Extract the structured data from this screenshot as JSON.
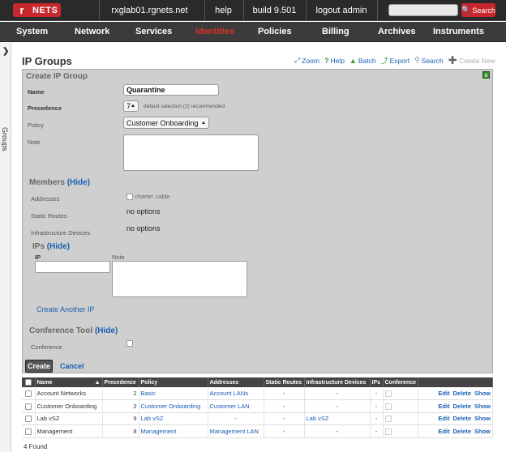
{
  "topbar": {
    "logo_letter": "r",
    "logo_text": "NETS",
    "host": "rxglab01.rgnets.net",
    "help": "help",
    "build": "build 9.501",
    "logout": "logout admin",
    "search_value": "",
    "search_label": "Search"
  },
  "nav": {
    "items": [
      "System",
      "Network",
      "Services",
      "Identities",
      "Policies",
      "Billing",
      "Archives",
      "Instruments"
    ],
    "active": "Identities",
    "active_color": "#d93025"
  },
  "sidebar": {
    "label": "Groups"
  },
  "page": {
    "title": "IP Groups"
  },
  "toolbar": {
    "zoom": "Zoom",
    "help": "Help",
    "batch": "Batch",
    "export": "Export",
    "search": "Search",
    "create_new": "Create New"
  },
  "form": {
    "title": "Create IP Group",
    "name_label": "Name",
    "name_value": "Quarantine",
    "precedence_label": "Precedence",
    "precedence_value": "7",
    "precedence_hint": "default selection (2) recommended",
    "policy_label": "Policy",
    "policy_value": "Customer Onboarding",
    "note_label": "Note",
    "members_head": "Members",
    "hide": "(Hide)",
    "addresses_label": "Addresses",
    "addresses_option": "charter cable",
    "static_routes_label": "Static Routes",
    "static_routes_value": "no options",
    "infra_label": "Infrastructure Devices",
    "infra_value": "no options",
    "ips_head": "IPs",
    "ip_col": "IP",
    "note_col": "Note",
    "create_another": "Create Another IP",
    "conf_head": "Conference Tool",
    "conference_label": "Conference",
    "create_button": "Create",
    "cancel_link": "Cancel"
  },
  "table": {
    "headers": [
      "Name",
      "Precedence",
      "Policy",
      "Addresses",
      "Static Routes",
      "Infrastructure Devices",
      "IPs",
      "Conference"
    ],
    "actions": [
      "Edit",
      "Delete",
      "Show"
    ],
    "rows": [
      {
        "name": "Account Networks",
        "precedence": "2",
        "policy": "Basic",
        "addresses": "Account LANs",
        "static_routes": "-",
        "infra": "-",
        "ips": "-"
      },
      {
        "name": "Customer Onboarding",
        "precedence": "2",
        "policy": "Customer Onboarding",
        "addresses": "Customer LAN",
        "static_routes": "-",
        "infra": "-",
        "ips": "-"
      },
      {
        "name": "Lab vSZ",
        "precedence": "9",
        "policy": "Lab vSZ",
        "addresses": "-",
        "static_routes": "-",
        "infra": "Lab vSZ",
        "ips": "-"
      },
      {
        "name": "Management",
        "precedence": "8",
        "policy": "Management",
        "addresses": "Management LAN",
        "static_routes": "-",
        "infra": "-",
        "ips": "-"
      }
    ],
    "found": "4 Found"
  }
}
